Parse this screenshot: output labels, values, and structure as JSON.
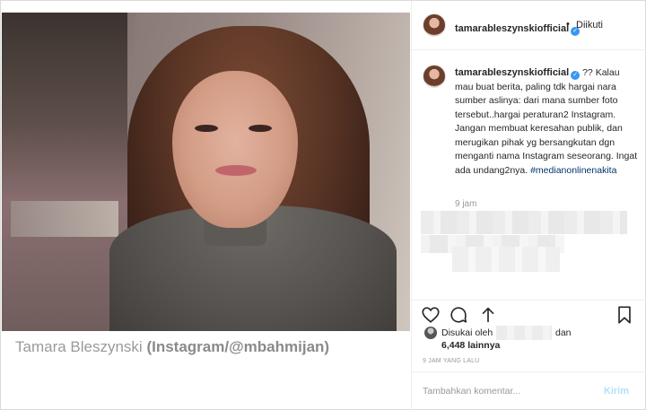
{
  "photo": {
    "caption_name": "Tamara Bleszynski",
    "caption_source": "(Instagram/@mbahmijan)"
  },
  "header": {
    "username": "tamarableszynskiofficial",
    "separator": "•",
    "follow_label": "Diikuti"
  },
  "comment": {
    "username": "tamarableszynskiofficial",
    "text": "?? Kalau mau buat berita, paling tdk hargai nara sumber aslinya: dari mana sumber foto tersebut..hargai peraturan2 Instagram. Jangan membuat keresahan publik, dan merugikan pihak yg bersangkutan dgn menganti nama Instagram seseorang. Ingat ada undang2nya.",
    "hashtag": "#medianonlinenakita",
    "time": "9 jam"
  },
  "actions": {
    "like_icon": "heart-icon",
    "comment_icon": "comment-icon",
    "share_icon": "share-icon",
    "save_icon": "bookmark-icon"
  },
  "likes": {
    "prefix": "Disukai oleh",
    "conjunction": "dan",
    "count": "6,448 lainnya"
  },
  "posted_time": "9 JAM YANG LALU",
  "add_comment": {
    "placeholder": "Tambahkan komentar...",
    "send_label": "Kirim"
  },
  "colors": {
    "link": "#003569",
    "verified": "#3897f0",
    "send_disabled": "#b2dffc",
    "muted": "#999999"
  }
}
